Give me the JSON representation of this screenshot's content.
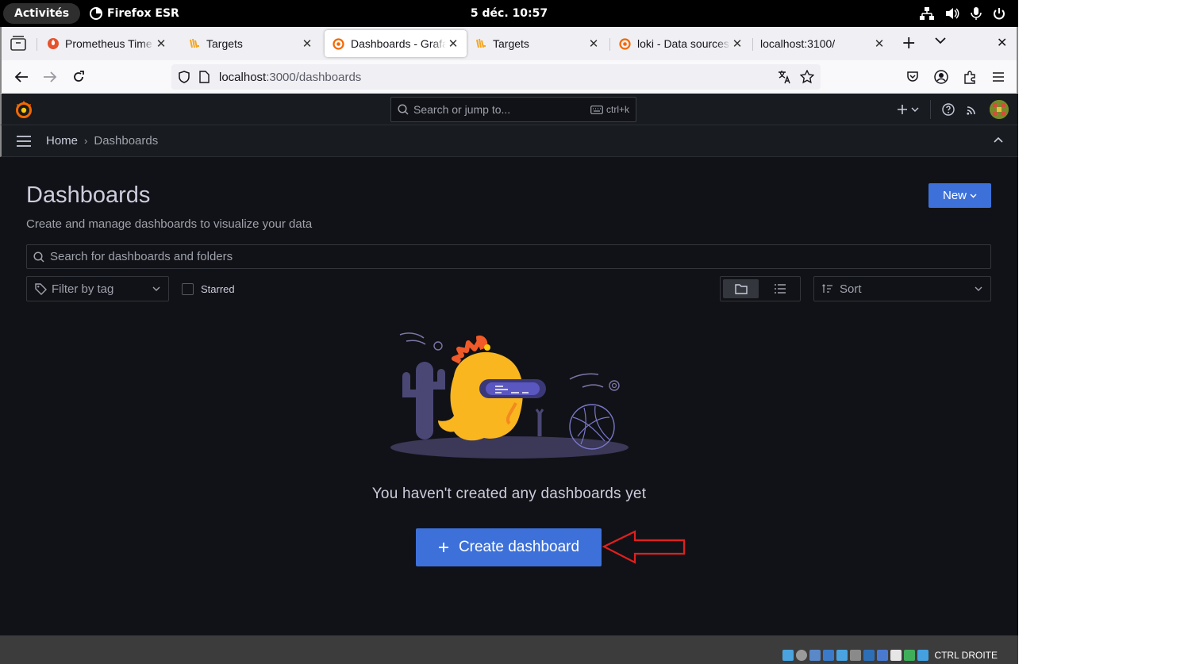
{
  "gnome": {
    "activities": "Activités",
    "app_name": "Firefox ESR",
    "clock": "5 déc.  10:57"
  },
  "browser": {
    "tabs": [
      {
        "title": "Prometheus Time Series",
        "favicon": "prometheus-icon",
        "active": false
      },
      {
        "title": "Targets",
        "favicon": "loki-icon",
        "active": false
      },
      {
        "title": "Dashboards - Grafana",
        "favicon": "grafana-icon",
        "active": true
      },
      {
        "title": "Targets",
        "favicon": "loki-icon",
        "active": false
      },
      {
        "title": "loki - Data sources",
        "favicon": "grafana-icon",
        "active": false
      },
      {
        "title": "localhost:3100/",
        "favicon": "",
        "active": false
      }
    ],
    "url_host": "localhost",
    "url_rest": ":3000/dashboards"
  },
  "grafana": {
    "search_placeholder": "Search or jump to...",
    "search_shortcut": "ctrl+k",
    "breadcrumb": {
      "home": "Home",
      "current": "Dashboards"
    },
    "page": {
      "title": "Dashboards",
      "subtitle": "Create and manage dashboards to visualize your data",
      "new_button": "New",
      "search_placeholder": "Search for dashboards and folders",
      "tag_filter_placeholder": "Filter by tag",
      "starred_label": "Starred",
      "sort_label": "Sort",
      "empty_message": "You haven't created any dashboards yet",
      "create_button": "Create dashboard"
    }
  },
  "vm": {
    "host_key": "CTRL DROITE"
  },
  "colors": {
    "primary": "#3d71d9",
    "background": "#111217",
    "panel": "#181b1f",
    "annotation_arrow": "#e0201e"
  }
}
